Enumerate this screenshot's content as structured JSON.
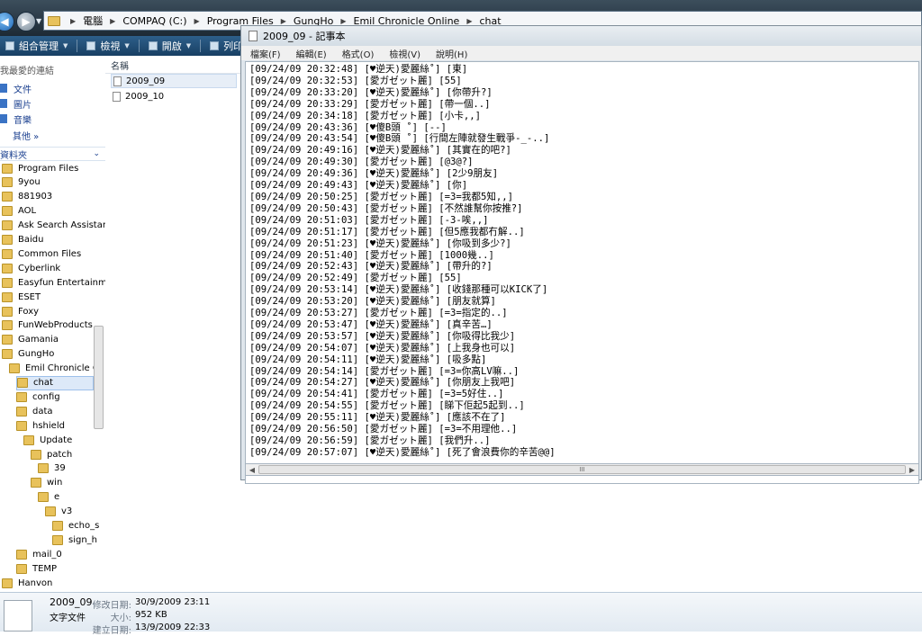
{
  "address_bar": {
    "crumbs": [
      "電腦",
      "COMPAQ (C:)",
      "Program Files",
      "GungHo",
      "Emil Chronicle Online",
      "chat"
    ]
  },
  "toolbar": {
    "organize": "組合管理",
    "views": "檢視",
    "open": "開啟",
    "print": "列印"
  },
  "nav_pane": {
    "favorites_heading": "我最愛的連結",
    "favorites": [
      "文件",
      "圖片",
      "音樂"
    ],
    "more_label": "其他 »",
    "folders_label": "資料夾",
    "tree": [
      {
        "label": "Program Files",
        "level": 0
      },
      {
        "label": "9you",
        "level": 0
      },
      {
        "label": "881903",
        "level": 0
      },
      {
        "label": "AOL",
        "level": 0
      },
      {
        "label": "Ask Search Assistan",
        "level": 0
      },
      {
        "label": "Baidu",
        "level": 0
      },
      {
        "label": "Common Files",
        "level": 0
      },
      {
        "label": "Cyberlink",
        "level": 0
      },
      {
        "label": "Easyfun Entertainm",
        "level": 0
      },
      {
        "label": "ESET",
        "level": 0
      },
      {
        "label": "Foxy",
        "level": 0
      },
      {
        "label": "FunWebProducts",
        "level": 0
      },
      {
        "label": "Gamania",
        "level": 0
      },
      {
        "label": "GungHo",
        "level": 0
      },
      {
        "label": "Emil Chronicle Or",
        "level": 1
      },
      {
        "label": "chat",
        "level": 2,
        "selected": true
      },
      {
        "label": "config",
        "level": 2
      },
      {
        "label": "data",
        "level": 2
      },
      {
        "label": "hshield",
        "level": 2
      },
      {
        "label": "Update",
        "level": 3
      },
      {
        "label": "patch",
        "level": 4
      },
      {
        "label": "39",
        "level": 5
      },
      {
        "label": "win",
        "level": 4
      },
      {
        "label": "e",
        "level": 5
      },
      {
        "label": "v3",
        "level": 6
      },
      {
        "label": "echo_s",
        "level": 7
      },
      {
        "label": "sign_h",
        "level": 7
      },
      {
        "label": "mail_0",
        "level": 2
      },
      {
        "label": "TEMP",
        "level": 2
      },
      {
        "label": "Hanvon",
        "level": 0
      }
    ]
  },
  "file_list": {
    "column_name": "名稱",
    "files": [
      {
        "name": "2009_09",
        "selected": true
      },
      {
        "name": "2009_10",
        "selected": false
      }
    ]
  },
  "details": {
    "name": "2009_09",
    "type": "文字文件",
    "modified_label": "修改日期:",
    "modified_value": "30/9/2009 23:11",
    "size_label": "大小:",
    "size_value": "952 KB",
    "created_label": "建立日期:",
    "created_value": "13/9/2009 22:33"
  },
  "notepad": {
    "title": "2009_09 - 記事本",
    "menu": [
      "檔案(F)",
      "編輯(E)",
      "格式(O)",
      "檢視(V)",
      "說明(H)"
    ],
    "lines": [
      "[09/24/09 20:32:48] [♥逆天)愛麗絲˚] [東]",
      "[09/24/09 20:32:53] [愛ガゼット麗] [55]",
      "[09/24/09 20:33:20] [♥逆天)愛麗絲˚] [你帶升?]",
      "[09/24/09 20:33:29] [愛ガゼット麗] [帶一個..]",
      "[09/24/09 20:34:18] [愛ガゼット麗] [小卡,,]",
      "[09/24/09 20:43:36] [♥傻B頭 ˚] [--]",
      "[09/24/09 20:43:54] [♥傻B頭 ˚] [行間左陣就發生戰爭-_-..]",
      "[09/24/09 20:49:16] [♥逆天)愛麗絲˚] [其實在的吧?]",
      "[09/24/09 20:49:30] [愛ガゼット麗] [@3@?]",
      "[09/24/09 20:49:36] [♥逆天)愛麗絲˚] [2少9朋友]",
      "[09/24/09 20:49:43] [♥逆天)愛麗絲˚] [你]",
      "[09/24/09 20:50:25] [愛ガゼット麗] [=3=我都5知,,]",
      "[09/24/09 20:50:43] [愛ガゼット麗] [不然誰幫你按推?]",
      "[09/24/09 20:51:03] [愛ガゼット麗] [-3-唉,,]",
      "[09/24/09 20:51:17] [愛ガゼット麗] [但5應我都冇解..]",
      "[09/24/09 20:51:23] [♥逆天)愛麗絲˚] [你吸到多少?]",
      "[09/24/09 20:51:40] [愛ガゼット麗] [1000幾..]",
      "[09/24/09 20:52:43] [♥逆天)愛麗絲˚] [帶升的?]",
      "[09/24/09 20:52:49] [愛ガゼット麗] [55]",
      "[09/24/09 20:53:14] [♥逆天)愛麗絲˚] [收錢那種可以KICK了]",
      "[09/24/09 20:53:20] [♥逆天)愛麗絲˚] [朋友就算]",
      "[09/24/09 20:53:27] [愛ガゼット麗] [=3=指定的..]",
      "[09/24/09 20:53:47] [♥逆天)愛麗絲˚] [真辛苦…]",
      "[09/24/09 20:53:57] [♥逆天)愛麗絲˚] [你吸得比我少]",
      "[09/24/09 20:54:07] [♥逆天)愛麗絲˚] [上我身也可以]",
      "[09/24/09 20:54:11] [♥逆天)愛麗絲˚] [吸多點]",
      "[09/24/09 20:54:14] [愛ガゼット麗] [=3=你高LV嘛..]",
      "[09/24/09 20:54:27] [♥逆天)愛麗絲˚] [你朋友上我吧]",
      "[09/24/09 20:54:41] [愛ガゼット麗] [=3=5好住..]",
      "[09/24/09 20:54:55] [愛ガゼット麗] [睇下佢起5起到..]",
      "[09/24/09 20:55:11] [♥逆天)愛麗絲˚] [應該不在了]",
      "[09/24/09 20:56:50] [愛ガゼット麗] [=3=不用理他..]",
      "[09/24/09 20:56:59] [愛ガゼット麗] [我們升..]",
      "[09/24/09 20:57:07] [♥逆天)愛麗絲˚] [死了會浪費你的辛苦@@]"
    ],
    "hscroll_grip": "III"
  }
}
